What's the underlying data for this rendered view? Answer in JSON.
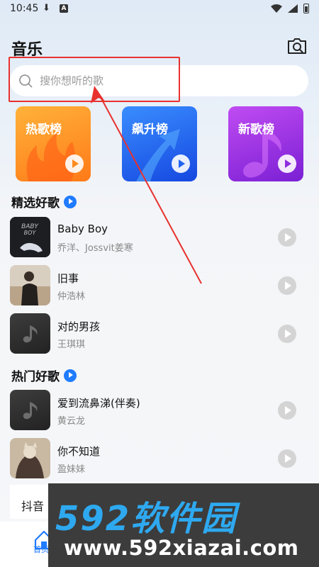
{
  "status_bar": {
    "time": "10:45"
  },
  "header": {
    "title": "音乐"
  },
  "search": {
    "placeholder": "搜你想听的歌"
  },
  "charts": [
    {
      "label": "热歌榜"
    },
    {
      "label": "飙升榜"
    },
    {
      "label": "新歌榜"
    }
  ],
  "featured": {
    "title": "精选好歌",
    "songs": [
      {
        "name": "Baby Boy",
        "artist": "乔洋、Jossvit姜寒",
        "cover_text": "BABY BOY"
      },
      {
        "name": "旧事",
        "artist": "仲浩林"
      },
      {
        "name": "对的男孩",
        "artist": "王琪琪"
      }
    ]
  },
  "popular": {
    "title": "热门好歌",
    "songs": [
      {
        "name": "爱到流鼻涕(伴奏)",
        "artist": "黄云龙"
      },
      {
        "name": "你不知道",
        "artist": "盈妹妹"
      }
    ]
  },
  "tab_strip": {
    "label": "抖音"
  },
  "bottom_nav": {
    "home_label": "首页"
  },
  "watermark": {
    "top": "592软件园",
    "bottom": "www.592xiazai.com"
  },
  "colors": {
    "accent": "#1f7bff",
    "highlight": "#e8312f"
  }
}
